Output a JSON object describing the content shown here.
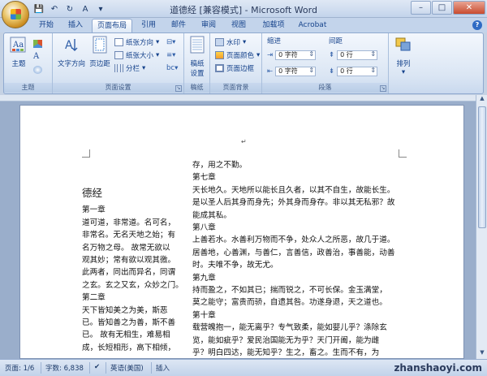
{
  "window": {
    "title": "道德经 [兼容模式] - Microsoft Word"
  },
  "tabs": [
    "开始",
    "插入",
    "页面布局",
    "引用",
    "邮件",
    "审阅",
    "视图",
    "加载项",
    "Acrobat"
  ],
  "active_tab": "页面布局",
  "ribbon": {
    "groups": {
      "theme": "主题",
      "page_setup": "页面设置",
      "manuscript": "稿纸",
      "page_background": "页面背景",
      "paragraph": "段落",
      "arrange": "排列"
    },
    "theme_button": "主题",
    "text_direction": "文字方向",
    "margins": "页边距",
    "orientation": "纸张方向",
    "size": "纸张大小",
    "columns": "分栏",
    "manuscript_setup_line1": "稿纸",
    "manuscript_setup_line2": "设置",
    "watermark": "水印",
    "page_color": "页面颜色",
    "page_borders": "页面边框",
    "indent_title": "缩进",
    "spacing_title": "间距",
    "indent_left": "0 字符",
    "indent_right": "0 字符",
    "spacing_before": "0 行",
    "spacing_after": "0 行",
    "arrange_button": "排列"
  },
  "document": {
    "left_column": {
      "title": "德经",
      "lines": [
        "第一章",
        "道可道，非常道。名可名，",
        "非常名。无名天地之始；有",
        "名万物之母。 故常无欲以",
        "观其妙；常有欲以观其徼。",
        "此两者，同出而异名，同谓",
        "之玄。玄之又玄，众妙之门。",
        "第二章",
        "天下皆知美之为美，斯恶",
        "已。皆知善之为善，斯不善",
        "已。 故有无相生，难易相",
        "成，长短相形，高下相倾，"
      ]
    },
    "right_column": {
      "lines": [
        "存，用之不勤。",
        "第七章",
        "天长地久。天地所以能长且久者，以其不自生，故能长生。",
        "是以圣人后其身而身先；外其身而身存。非以其无私邪？故",
        "能成其私。",
        "第八章",
        "上善若水。水善利万物而不争，处众人之所恶，故几于道。",
        "居善地，心善渊，与善仁，言善信，政善治，事善能，动善",
        "时。夫唯不争，故无尤。",
        "第九章",
        "持而盈之，不如其已；揣而锐之，不可长保。金玉满堂，",
        "莫之能守；富贵而骄，自遗其咎。功遂身退，天之道也。",
        "第十章",
        "载营魄抱一，能无离乎？专气致柔，能如婴儿乎？涤除玄",
        "览，能如疵乎？爱民治国能无为乎？天门开阖，能为雌",
        "乎？明白四达，能无知乎？生之，畜之。生而不有，为"
      ]
    }
  },
  "statusbar": {
    "page": "页面: 1/6",
    "words": "字数: 6,838",
    "language": "英语(美国)",
    "mode": "插入",
    "watermark": "zhanshaoyi.com"
  }
}
